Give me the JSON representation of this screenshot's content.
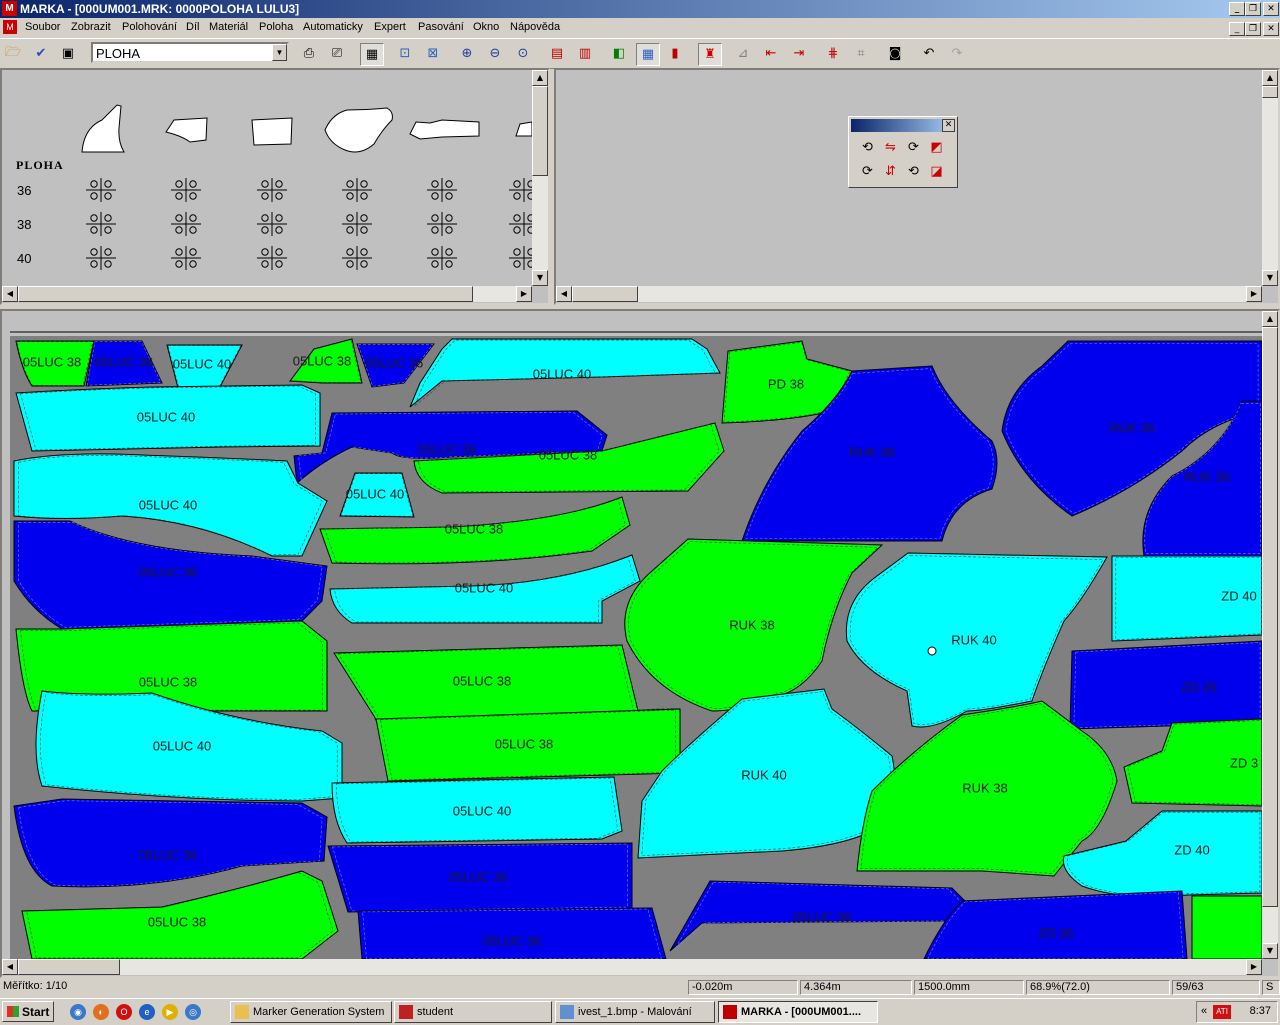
{
  "window": {
    "title": "MARKA - [000UM001.MRK: 0000POLOHA LULU3]",
    "controls": [
      "_",
      "❐",
      "✕"
    ]
  },
  "menu": {
    "items": [
      "Soubor",
      "Zobrazit",
      "Polohování",
      "Díl",
      "Materiál",
      "Poloha",
      "Automaticky",
      "Expert",
      "Pasování",
      "Okno",
      "Nápověda"
    ]
  },
  "toolbar": {
    "combo_value": "PLOHA"
  },
  "pieces_panel": {
    "title": "PLOHA",
    "sizes": [
      "36",
      "38",
      "40"
    ]
  },
  "marker": {
    "pieces": [
      {
        "label": "05LUC 38",
        "color": "green"
      },
      {
        "label": "05LUC 36",
        "color": "blue"
      },
      {
        "label": "05LUC 40",
        "color": "cyan"
      },
      {
        "label": "05LUC 38",
        "color": "green"
      },
      {
        "label": "05LUC 36",
        "color": "blue"
      },
      {
        "label": "05LUC 40",
        "color": "cyan"
      },
      {
        "label": "PD 38",
        "color": "green"
      },
      {
        "label": "RUK 36",
        "color": "blue"
      },
      {
        "label": "RUK 36",
        "color": "blue"
      },
      {
        "label": "RUK 36",
        "color": "blue"
      },
      {
        "label": "05LUC 40",
        "color": "cyan"
      },
      {
        "label": "05LUC 36",
        "color": "blue"
      },
      {
        "label": "05LUC 38",
        "color": "green"
      },
      {
        "label": "05LUC 40",
        "color": "cyan"
      },
      {
        "label": "05LUC 40",
        "color": "cyan"
      },
      {
        "label": "05LUC 38",
        "color": "green"
      },
      {
        "label": "05LUC 36",
        "color": "blue"
      },
      {
        "label": "05LUC 40",
        "color": "cyan"
      },
      {
        "label": "RUK 38",
        "color": "green"
      },
      {
        "label": "RUK 40",
        "color": "cyan"
      },
      {
        "label": "ZD 40",
        "color": "cyan"
      },
      {
        "label": "05LUC 38",
        "color": "green"
      },
      {
        "label": "05LUC 38",
        "color": "green"
      },
      {
        "label": "ZD 36",
        "color": "blue"
      },
      {
        "label": "05LUC 40",
        "color": "cyan"
      },
      {
        "label": "05LUC 38",
        "color": "green"
      },
      {
        "label": "RUK 40",
        "color": "cyan"
      },
      {
        "label": "RUK 38",
        "color": "green"
      },
      {
        "label": "ZD 3",
        "color": "green"
      },
      {
        "label": "05LUC 40",
        "color": "cyan"
      },
      {
        "label": "ZD 40",
        "color": "cyan"
      },
      {
        "label": "05LUC 36",
        "color": "blue"
      },
      {
        "label": "05LUC 36",
        "color": "blue"
      },
      {
        "label": "05LUC 38",
        "color": "green"
      },
      {
        "label": "05LUC 36",
        "color": "blue"
      },
      {
        "label": "05LUC 36",
        "color": "blue"
      },
      {
        "label": "ZD 36",
        "color": "blue"
      }
    ]
  },
  "colors": {
    "green": "#00ff00",
    "blue": "#0000ee",
    "cyan": "#00ffff",
    "fabric": "#808080"
  },
  "status": {
    "scale": "Měřítko: 1/10",
    "x": "-0.020m",
    "length": "4.364m",
    "width": "1500.0mm",
    "efficiency": "68.9%(72.0)",
    "count": "59/63",
    "mode": "S"
  },
  "taskbar": {
    "start": "Start",
    "tasks": [
      "Marker Generation System",
      "student",
      "ivest_1.bmp - Malování",
      "MARKA - [000UM001...."
    ],
    "clock": "8:37"
  }
}
